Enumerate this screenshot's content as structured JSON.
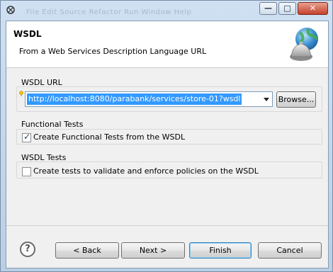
{
  "window": {
    "title": "",
    "ghost_menu": "File  Edit  Source  Refactor  Run  Window  Help",
    "min_glyph": "—",
    "max_glyph": "□",
    "close_glyph": "✕"
  },
  "header": {
    "title": "WSDL",
    "description": "From a Web Services Description Language URL"
  },
  "wsdl_url": {
    "group_label": "WSDL URL",
    "value": "http://localhost:8080/parabank/services/store-01?wsdl",
    "browse_label": "Browse..."
  },
  "functional_tests": {
    "group_label": "Functional Tests",
    "checkbox_label": "Create Functional Tests from the WSDL",
    "checked": true,
    "check_glyph": "✓"
  },
  "wsdl_tests": {
    "group_label": "WSDL Tests",
    "checkbox_label": "Create tests to validate and enforce policies on the WSDL",
    "checked": false
  },
  "footer": {
    "help_glyph": "?",
    "back_label": "< Back",
    "next_label": "Next >",
    "finish_label": "Finish",
    "cancel_label": "Cancel"
  },
  "icons": [
    "app-icon",
    "globe-bell-icon",
    "warning-icon",
    "dropdown-arrow-icon",
    "help-icon"
  ]
}
